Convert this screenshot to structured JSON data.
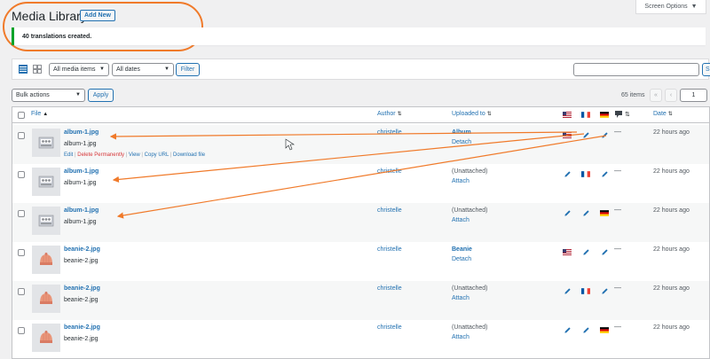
{
  "screen_options": {
    "label": "Screen Options"
  },
  "header": {
    "title": "Media Library",
    "add_new": "Add New"
  },
  "notice": {
    "message": "40 translations created."
  },
  "toolbar": {
    "filter_type": "All media items",
    "filter_date": "All dates",
    "filter_button": "Filter",
    "search_button": "S",
    "bulk_actions": "Bulk actions",
    "apply": "Apply"
  },
  "pagination": {
    "count": "65 items",
    "first": "«",
    "prev": "‹",
    "current_page": "1"
  },
  "columns": {
    "file": "File",
    "author": "Author",
    "uploaded_to": "Uploaded to",
    "date": "Date"
  },
  "row_actions": [
    "Edit",
    "Delete Permanently",
    "View",
    "Copy URL",
    "Download file"
  ],
  "rows": [
    {
      "title": "album-1.jpg",
      "filename": "album-1.jpg",
      "author": "christelle",
      "uploaded": "Album",
      "uploaded_action": "Detach",
      "date": "22 hours ago",
      "thumb": "album",
      "lang_icons": [
        "us-flag",
        "pencil",
        "pencil"
      ]
    },
    {
      "title": "album-1.jpg",
      "filename": "album-1.jpg",
      "author": "christelle",
      "uploaded": "(Unattached)",
      "uploaded_action": "Attach",
      "date": "22 hours ago",
      "thumb": "album",
      "lang_icons": [
        "pencil",
        "fr-flag",
        "pencil"
      ]
    },
    {
      "title": "album-1.jpg",
      "filename": "album-1.jpg",
      "author": "christelle",
      "uploaded": "(Unattached)",
      "uploaded_action": "Attach",
      "date": "22 hours ago",
      "thumb": "album",
      "lang_icons": [
        "pencil",
        "pencil",
        "de-flag"
      ]
    },
    {
      "title": "beanie-2.jpg",
      "filename": "beanie-2.jpg",
      "author": "christelle",
      "uploaded": "Beanie",
      "uploaded_action": "Detach",
      "date": "22 hours ago",
      "thumb": "beanie",
      "lang_icons": [
        "us-flag",
        "pencil",
        "pencil"
      ]
    },
    {
      "title": "beanie-2.jpg",
      "filename": "beanie-2.jpg",
      "author": "christelle",
      "uploaded": "(Unattached)",
      "uploaded_action": "Attach",
      "date": "22 hours ago",
      "thumb": "beanie",
      "lang_icons": [
        "pencil",
        "fr-flag",
        "pencil"
      ]
    },
    {
      "title": "beanie-2.jpg",
      "filename": "beanie-2.jpg",
      "author": "christelle",
      "uploaded": "(Unattached)",
      "uploaded_action": "Attach",
      "date": "22 hours ago",
      "thumb": "beanie",
      "lang_icons": [
        "pencil",
        "pencil",
        "de-flag"
      ]
    }
  ],
  "colors": {
    "accent": "#2271b1",
    "success": "#00a32a",
    "danger": "#d63638",
    "annotation": "#f07a2a"
  }
}
